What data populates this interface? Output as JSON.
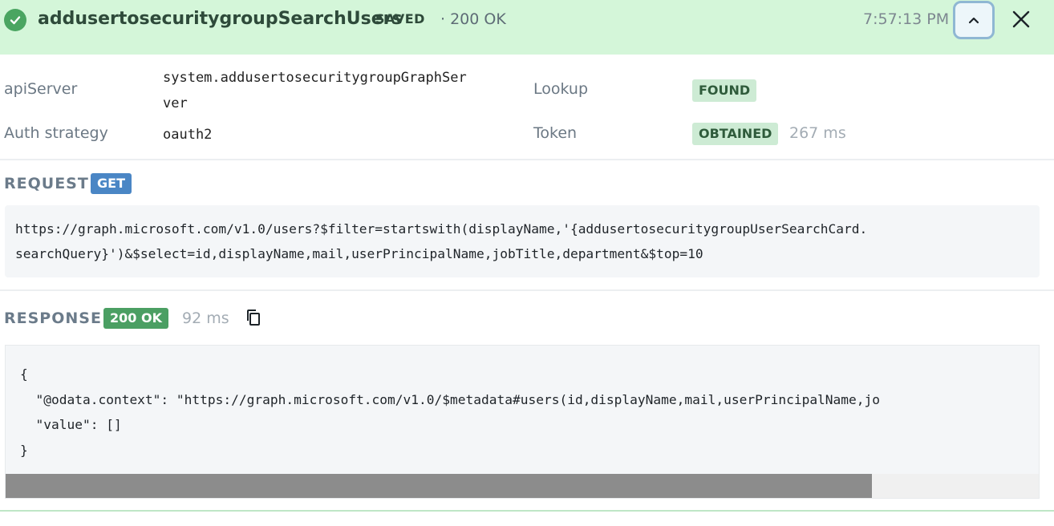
{
  "header": {
    "title": "addusertosecuritygroupSearchUsers",
    "saved_label": "SAVED",
    "status_text": "· 200 OK",
    "time": "7:57:13 PM",
    "icons": {
      "status": "check-circle-icon",
      "collapse": "chevron-up-icon",
      "close": "close-icon"
    },
    "accent_color": "#4aa561",
    "background_color": "#d4f6d9"
  },
  "meta": {
    "api_server_label": "apiServer",
    "api_server_value": "system.addusertosecuritygroupGraphSer\nver",
    "auth_label": "Auth strategy",
    "auth_value": "oauth2",
    "lookup_label": "Lookup",
    "lookup_badge": "FOUND",
    "token_label": "Token",
    "token_badge": "OBTAINED",
    "token_time": "267 ms"
  },
  "request": {
    "section_label": "REQUEST",
    "method": "GET",
    "method_color": "#4a86c5",
    "url": "https://graph.microsoft.com/v1.0/users?$filter=startswith(displayName,'{addusertosecuritygroupUserSearchCard.\nsearchQuery}')&$select=id,displayName,mail,userPrincipalName,jobTitle,department&$top=10"
  },
  "response": {
    "section_label": "RESPONSE",
    "status_badge": "200 OK",
    "status_color": "#4b9f63",
    "time": "92 ms",
    "copy_icon": "copy-icon",
    "body": "{\n  \"@odata.context\": \"https://graph.microsoft.com/v1.0/$metadata#users(id,displayName,mail,userPrincipalName,jo\n  \"value\": []\n}"
  }
}
